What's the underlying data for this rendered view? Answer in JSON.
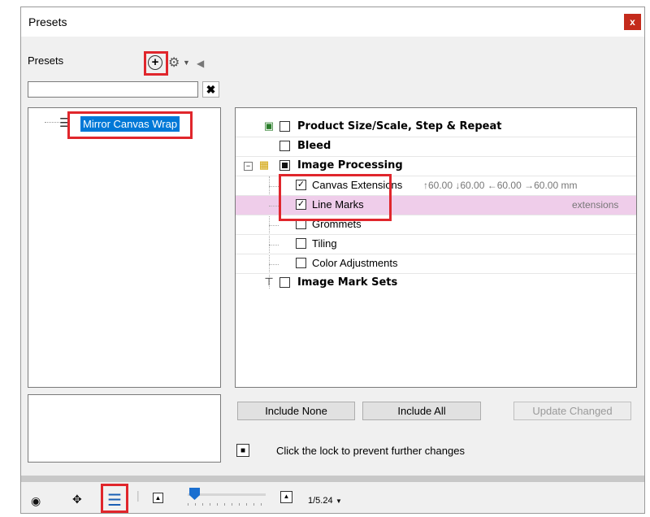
{
  "window": {
    "title": "Presets",
    "close_label": "x"
  },
  "left": {
    "presets_label": "Presets",
    "search": {
      "value": "",
      "placeholder": ""
    },
    "clear_label": "✖",
    "tree": [
      {
        "label": "Mirror Canvas Wrap",
        "selected": true
      }
    ]
  },
  "options": [
    {
      "label": "Product Size/Scale, Step & Repeat",
      "checked": false,
      "bold": true
    },
    {
      "label": "Bleed",
      "checked": false,
      "bold": true
    },
    {
      "label": "Image Processing",
      "checked": "partial",
      "bold": true
    },
    {
      "label": "Canvas Extensions",
      "checked": true,
      "bold": false,
      "measurements": "↑60.00  ↓60.00  ←60.00  →60.00 mm"
    },
    {
      "label": "Line Marks",
      "checked": true,
      "bold": false,
      "note": "extensions",
      "highlighted": true
    },
    {
      "label": "Grommets",
      "checked": false,
      "bold": false
    },
    {
      "label": "Tiling",
      "checked": false,
      "bold": false
    },
    {
      "label": "Color Adjustments",
      "checked": false,
      "bold": false
    },
    {
      "label": "Image Mark Sets",
      "checked": false,
      "bold": true
    }
  ],
  "buttons": {
    "include_none": "Include None",
    "include_all": "Include All",
    "update_changed": "Update Changed"
  },
  "lock_text": "Click the lock to prevent further changes",
  "bottom": {
    "zoom": "1/5.24"
  },
  "colors": {
    "selection": "#0078d7",
    "highlight_row": "#efcdea",
    "callout": "#e0262c",
    "close": "#c42b1c"
  }
}
